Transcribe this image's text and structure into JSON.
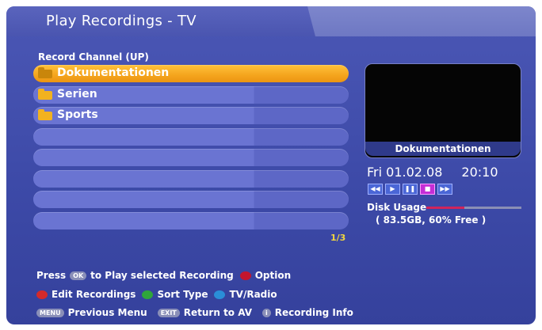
{
  "header": {
    "title": "Play Recordings - TV"
  },
  "list": {
    "header": "Record Channel (UP)",
    "items": [
      {
        "label": "Dokumentationen",
        "selected": true,
        "folder": true
      },
      {
        "label": "Serien",
        "selected": false,
        "folder": true
      },
      {
        "label": "Sports",
        "selected": false,
        "folder": true
      },
      {
        "label": "",
        "selected": false,
        "folder": false
      },
      {
        "label": "",
        "selected": false,
        "folder": false
      },
      {
        "label": "",
        "selected": false,
        "folder": false
      },
      {
        "label": "",
        "selected": false,
        "folder": false
      },
      {
        "label": "",
        "selected": false,
        "folder": false
      }
    ],
    "page": "1/3"
  },
  "preview": {
    "caption": "Dokumentationen",
    "date": "Fri 01.02.08",
    "time": "20:10",
    "controls": [
      "rewind-icon",
      "play-icon",
      "pause-icon",
      "stop-icon",
      "fast-forward-icon"
    ],
    "active_control": "stop-icon"
  },
  "disk": {
    "label": "Disk Usage",
    "detail": "( 83.5GB, 60% Free )",
    "used_fraction": 0.4
  },
  "help": {
    "line1": {
      "prefix": "Press",
      "key": "OK",
      "text": "to Play selected Recording",
      "option": "Option"
    },
    "line2": {
      "red": "Edit Recordings",
      "green": "Sort Type",
      "blue": "TV/Radio"
    },
    "line3": {
      "menu_key": "MENU",
      "menu": "Previous Menu",
      "exit_key": "EXIT",
      "exit": "Return to AV",
      "info_key": "i",
      "info": "Recording Info"
    }
  },
  "colors": {
    "accent": "#f4a41d",
    "red_key": "#d42a2a",
    "green_key": "#2fa63a",
    "blue_key": "#2a8ed8",
    "option_key": "#c2152e"
  }
}
